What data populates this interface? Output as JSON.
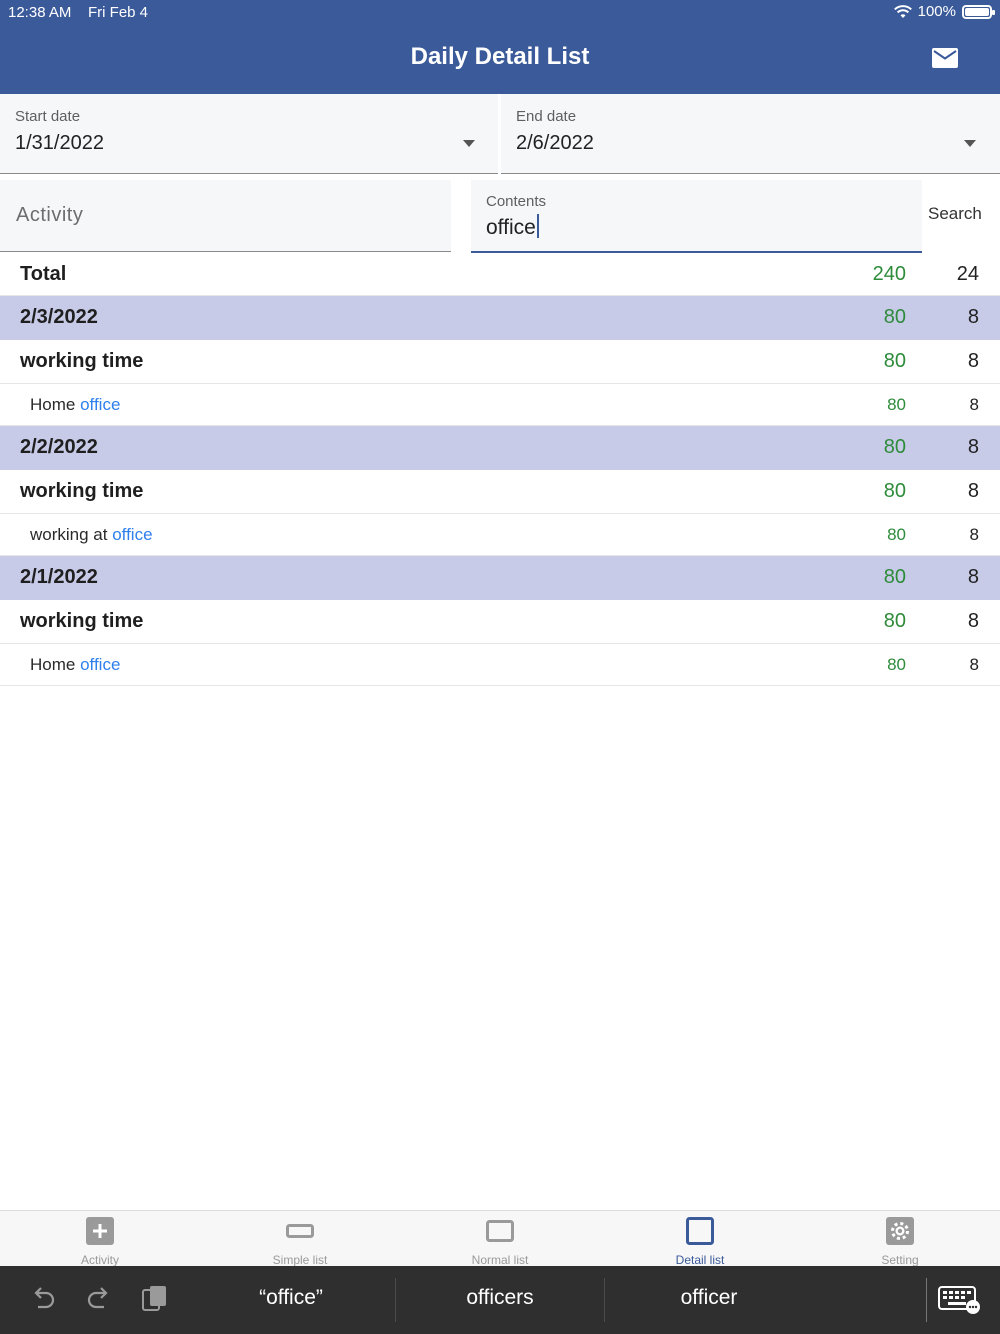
{
  "status": {
    "time": "12:38 AM",
    "date": "Fri Feb 4",
    "battery": "100%",
    "battery_level": 1.0
  },
  "header": {
    "title": "Daily Detail List"
  },
  "filters": {
    "start_label": "Start date",
    "start_value": "1/31/2022",
    "end_label": "End date",
    "end_value": "2/6/2022",
    "activity_placeholder": "Activity",
    "contents_label": "Contents",
    "contents_value": "office",
    "search_label": "Search"
  },
  "total": {
    "label": "Total",
    "amount": "240",
    "count": "24"
  },
  "days": [
    {
      "date": "2/3/2022",
      "amount": "80",
      "count": "8",
      "activity": {
        "label": "working time",
        "amount": "80",
        "count": "8"
      },
      "detail": {
        "prefix": "Home ",
        "match": "office",
        "amount": "80",
        "count": "8"
      }
    },
    {
      "date": "2/2/2022",
      "amount": "80",
      "count": "8",
      "activity": {
        "label": "working time",
        "amount": "80",
        "count": "8"
      },
      "detail": {
        "prefix": "working at ",
        "match": "office",
        "amount": "80",
        "count": "8"
      }
    },
    {
      "date": "2/1/2022",
      "amount": "80",
      "count": "8",
      "activity": {
        "label": "working time",
        "amount": "80",
        "count": "8"
      },
      "detail": {
        "prefix": "Home ",
        "match": "office",
        "amount": "80",
        "count": "8"
      }
    }
  ],
  "tabs": [
    {
      "label": "Activity",
      "icon": "plus-square-icon"
    },
    {
      "label": "Simple list",
      "icon": "simple-list-icon"
    },
    {
      "label": "Normal list",
      "icon": "normal-list-icon"
    },
    {
      "label": "Detail list",
      "icon": "detail-list-icon",
      "active": true
    },
    {
      "label": "Setting",
      "icon": "gear-icon"
    }
  ],
  "keyboard": {
    "suggestions": [
      "“office”",
      "officers",
      "officer"
    ]
  },
  "colors": {
    "brand": "#3b5a9a",
    "amount": "#2e8b3a",
    "highlight": "#2f80ed",
    "date_row": "#c7cbe8"
  }
}
